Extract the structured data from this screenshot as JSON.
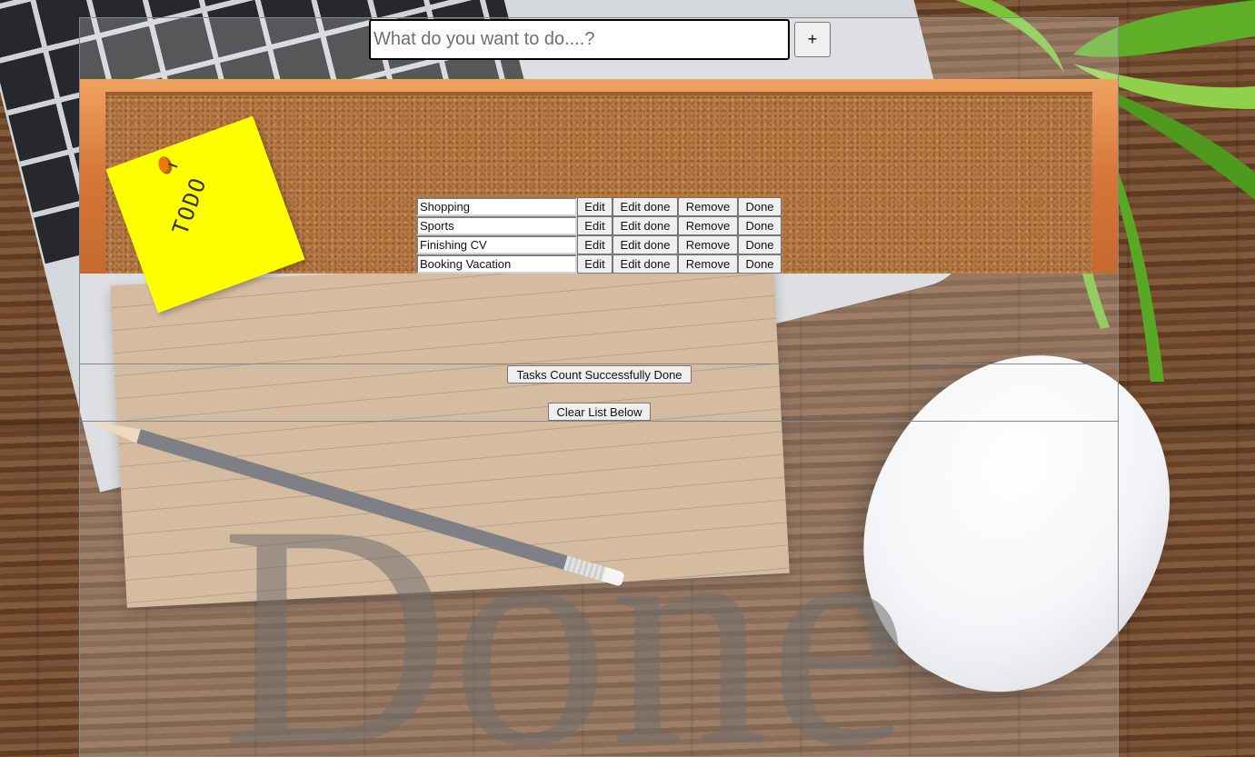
{
  "header": {
    "input_placeholder": "What do you want to do....?",
    "input_value": "",
    "add_label": "+"
  },
  "board": {
    "sticky_note_text": "TODO"
  },
  "tasks": [
    {
      "name": "Shopping",
      "edit_label": "Edit",
      "edit_done_label": "Edit done",
      "remove_label": "Remove",
      "done_label": "Done"
    },
    {
      "name": "Sports",
      "edit_label": "Edit",
      "edit_done_label": "Edit done",
      "remove_label": "Remove",
      "done_label": "Done"
    },
    {
      "name": "Finishing CV",
      "edit_label": "Edit",
      "edit_done_label": "Edit done",
      "remove_label": "Remove",
      "done_label": "Done"
    },
    {
      "name": "Booking Vacation",
      "edit_label": "Edit",
      "edit_done_label": "Edit done",
      "remove_label": "Remove",
      "done_label": "Done"
    }
  ],
  "controls": {
    "count_label": "Tasks Count Successfully Done",
    "clear_label": "Clear List Below"
  },
  "done_section": {
    "watermark": "Done"
  },
  "colors": {
    "sticky": "#ffff00",
    "frame": "#d5763a",
    "cork": "#b77a45"
  },
  "icons": {
    "pin": "pushpin-icon"
  }
}
